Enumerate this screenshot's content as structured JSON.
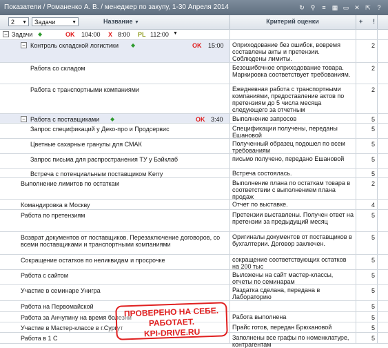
{
  "window": {
    "title": "Показатели / Романенко А. В. / менеджер по закупу, 1-30 Апреля 2014"
  },
  "toolbar": {
    "level_value": "2",
    "view_value": "Задачи",
    "icons": [
      "refresh-icon",
      "search-icon",
      "list-icon",
      "grid-icon",
      "minimize-icon",
      "close-icon",
      "share-icon",
      "help-icon"
    ]
  },
  "columns": {
    "name": "Название",
    "criteria": "Критерий оценки",
    "plus": "+",
    "ex": "!"
  },
  "root": {
    "label": "Задачи",
    "ok": "OK",
    "ok_value": "104:00",
    "x": "X",
    "x_value": "8:00",
    "pl": "PL",
    "pl_value": "112:00"
  },
  "rows": [
    {
      "name": "Контроль складской логистики",
      "ok": "OK",
      "time": "15:00",
      "criteria": "Оприходование без ошибок, вовремя составлены акты и претензии. Соблюдены лимиты.",
      "weight": "2"
    },
    {
      "name": "Работа со складом",
      "criteria": "Безошибочное оприходование товара. Маркировка соответствует требованиям.",
      "weight": "2"
    },
    {
      "name": "Работа с транспортными компаниями",
      "criteria": "Ежедневная работа с транспортными компаниями, предоставление актов по претензиям до 5 числа месяца следующего за отчетным",
      "weight": "2"
    },
    {
      "name": "Работа с поставщиками",
      "ok": "OK",
      "time": "3:40",
      "criteria": "Выполнение запросов",
      "weight": "5"
    },
    {
      "name": "Запрос спецификаций у Деко-про и Продсервис",
      "criteria": "Спецификации получены, переданы Ешановой",
      "weight": "5"
    },
    {
      "name": "Цветные сахарные гранулы для СМАК",
      "criteria": "Полученный образец подошел по всем требованиям",
      "weight": "5"
    },
    {
      "name": "Запрос письма для распространения ТУ у Бэйклаб",
      "criteria": "письмо получено, передано Ешановой",
      "weight": "5"
    },
    {
      "name": "Встреча с потенциальным поставщиком Kerry",
      "criteria": "Встреча состоялась.",
      "weight": "5"
    },
    {
      "name": "Выполнение лимитов по остаткам",
      "criteria": "Выполнение плана по остаткам товара в соответствии с выполнением плана продаж",
      "weight": "2"
    },
    {
      "name": "Командировка в Москву",
      "criteria": "Отчет по выставке.",
      "weight": "4"
    },
    {
      "name": "Работа по претензиям",
      "criteria": "Претензии выставлены. Получен ответ на претензии за предыдущий месяц",
      "weight": "5"
    },
    {
      "name": "Возврат документов от поставщиков. Перезаключение договоров, со всеми поставщиками и транспортными компаниями",
      "criteria": "Оригиналы документов от поставщиков в бухгалтерии. Договор заключен.",
      "weight": "5"
    },
    {
      "name": "Сокращение остатков по неликвидам и просрочке",
      "criteria": "сокращение соответствующих остатков на 200 тыс",
      "weight": "5"
    },
    {
      "name": "Работа с сайтом",
      "criteria": "Выложены на сайт мастер-классы, отчеты по семинарам",
      "weight": "5"
    },
    {
      "name": "Участие в семинаре Унигра",
      "criteria": "Раздатка сделана, передана в Лабораторию",
      "weight": "5"
    },
    {
      "name": "Работа на Первомайской",
      "criteria": "",
      "weight": "5"
    },
    {
      "name": "Работа за Анчупину на время болезни",
      "criteria": "Работа выполнена",
      "weight": "5"
    },
    {
      "name": "Участие в Мастер-классе в г.Сургут",
      "criteria": "Прайс готов, передан Брюхановой",
      "weight": "5"
    },
    {
      "name": "Работа в 1 С",
      "criteria": "Заполнены все графы по номенклатуре, контрагентам",
      "weight": "5"
    }
  ],
  "stamp": {
    "line1": "ПРОВЕРЕНО НА СЕБЕ.",
    "line2": "РАБОТАЕТ.",
    "line3": "KPI-DRIVE.RU"
  }
}
